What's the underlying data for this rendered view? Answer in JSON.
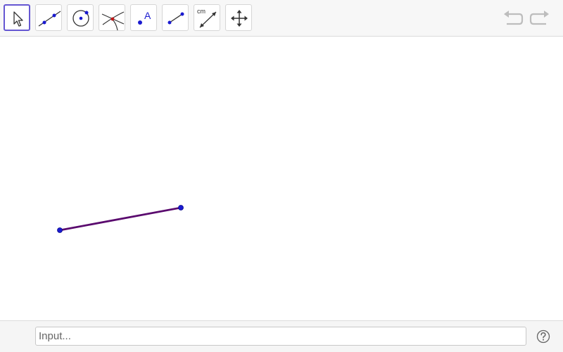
{
  "toolbar": {
    "tools": [
      {
        "name": "move-tool",
        "icon": "cursor-arrow-icon",
        "active": true
      },
      {
        "name": "line-tool",
        "icon": "line-through-two-points-icon",
        "active": false
      },
      {
        "name": "circle-tool",
        "icon": "circle-center-point-icon",
        "active": false
      },
      {
        "name": "intersect-tool",
        "icon": "intersect-icon",
        "active": false
      },
      {
        "name": "point-tool",
        "icon": "point-with-label-icon",
        "label": "A",
        "active": false
      },
      {
        "name": "segment-tool",
        "icon": "segment-icon",
        "active": false
      },
      {
        "name": "distance-tool",
        "icon": "distance-measure-icon",
        "label": "cm",
        "active": false
      },
      {
        "name": "move-view-tool",
        "icon": "move-arrows-icon",
        "active": false
      }
    ],
    "undo_icon": "undo-icon",
    "redo_icon": "redo-icon",
    "accent_color": "#6557d2"
  },
  "canvas": {
    "segment_color": "#5a0a6e",
    "point_color": "#1a1ad0"
  },
  "input_bar": {
    "placeholder": "Input...",
    "help_icon": "help-icon"
  }
}
